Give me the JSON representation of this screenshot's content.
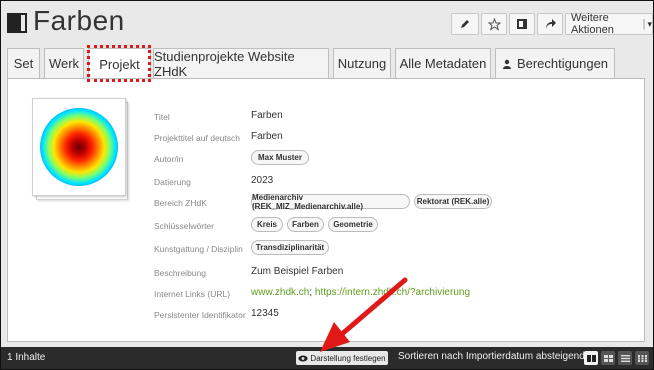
{
  "header": {
    "title": "Farben",
    "actions": [
      {
        "icon": "pencil-icon"
      },
      {
        "icon": "star-icon"
      },
      {
        "icon": "copy-icon"
      },
      {
        "icon": "share-icon"
      }
    ],
    "more_actions_label": "Weitere Aktionen",
    "more_actions_caret": "▾"
  },
  "tabs": [
    {
      "label": "Set",
      "active": false
    },
    {
      "label": "Werk",
      "active": false
    },
    {
      "label": "Projekt",
      "active": true
    },
    {
      "label": "Studienprojekte Website ZHdK",
      "active": false
    },
    {
      "label": "Nutzung",
      "active": false
    },
    {
      "label": "Alle Metadaten",
      "active": false
    },
    {
      "label": "Berechtigungen",
      "active": false,
      "icon": "user-icon"
    }
  ],
  "metadata": {
    "titel": {
      "label": "Titel",
      "value": "Farben"
    },
    "projekttitel": {
      "label": "Projekttitel auf deutsch",
      "value": "Farben"
    },
    "autor": {
      "label": "Autor/in",
      "pills": [
        "Max Muster"
      ]
    },
    "datierung": {
      "label": "Datierung",
      "value": "2023"
    },
    "bereich": {
      "label": "Bereich ZHdK",
      "pills": [
        "Medienarchiv (REK_MIZ_Medienarchiv.alle)",
        "Rektorat (REK.alle)"
      ]
    },
    "schlagworte": {
      "label": "Schlüsselwörter",
      "pills": [
        "Kreis",
        "Farben",
        "Geometrie"
      ]
    },
    "kunstgattung": {
      "label": "Kunstgattung / Disziplin",
      "pills": [
        "Transdiziplinarität"
      ]
    },
    "beschreibung": {
      "label": "Beschreibung",
      "value": "Zum Beispiel Farben"
    },
    "links": {
      "label": "Internet Links (URL)",
      "link1": "www.zhdk.ch",
      "separator": ";",
      "link2": "https://intern.zhdk.ch/?archivierung"
    },
    "identifikator": {
      "label": "Persistenter Identifikator",
      "value": "12345"
    }
  },
  "footer": {
    "count": "1 Inhalte",
    "display_button": "Darstellung festlegen",
    "sort_label": "Sortieren nach Importierdatum absteigend",
    "sort_caret": "▾"
  },
  "colors": {
    "highlight": "#e01818",
    "link": "#5f9d1e",
    "footer_bg": "#2b2b2b"
  }
}
